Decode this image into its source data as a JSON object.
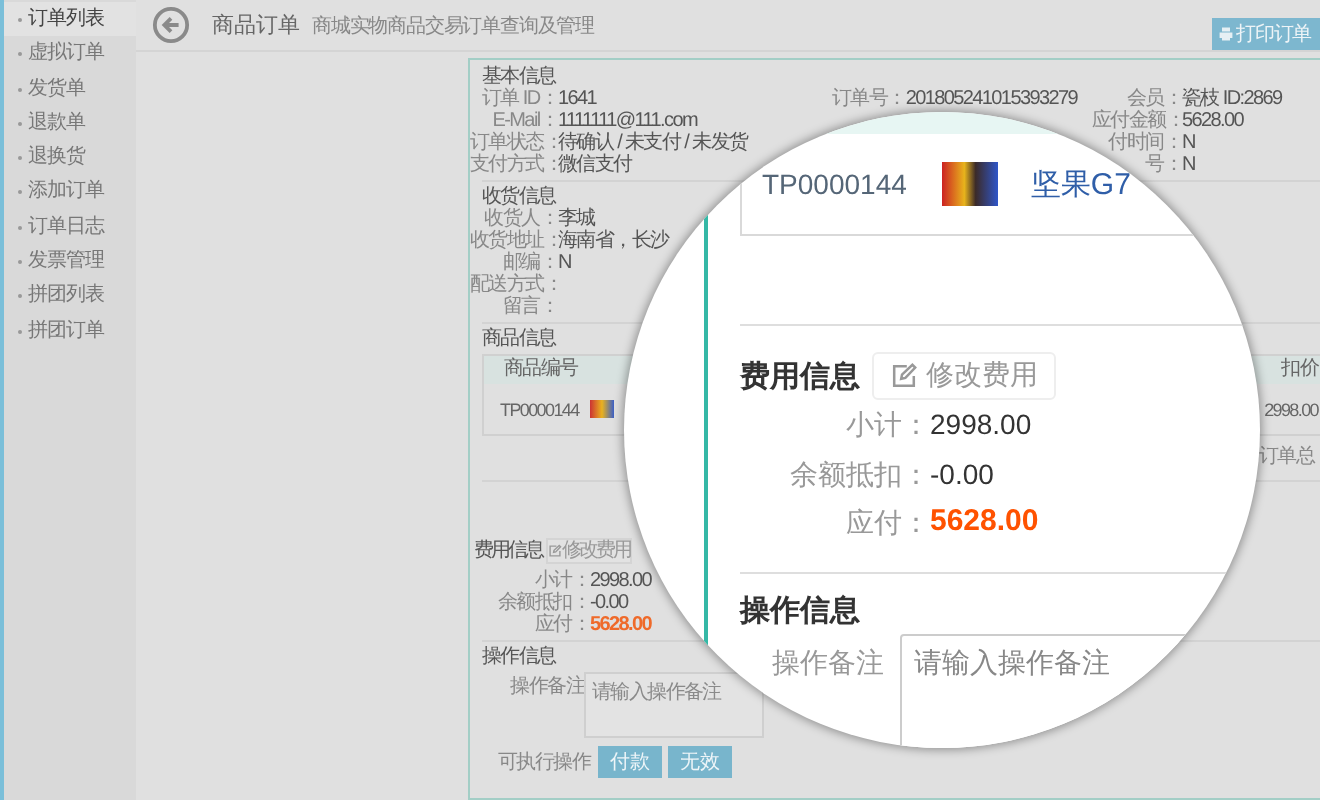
{
  "sidebar": {
    "items": [
      {
        "label": "订单列表",
        "selected": true
      },
      {
        "label": "虚拟订单",
        "selected": false
      },
      {
        "label": "发货单",
        "selected": false
      },
      {
        "label": "退款单",
        "selected": false
      },
      {
        "label": "退换货",
        "selected": false
      },
      {
        "label": "添加订单",
        "selected": false
      },
      {
        "label": "订单日志",
        "selected": false
      },
      {
        "label": "发票管理",
        "selected": false
      },
      {
        "label": "拼团列表",
        "selected": false
      },
      {
        "label": "拼团订单",
        "selected": false
      }
    ]
  },
  "header": {
    "title": "商品订单",
    "subtitle": "商城实物商品交易订单查询及管理",
    "print_button": "打印订单"
  },
  "basic_info": {
    "heading": "基本信息",
    "column_1": [
      {
        "label": "订单 ID：",
        "value": "1641"
      },
      {
        "label": "E-Mail：",
        "value": "1111111@111.com"
      },
      {
        "label": "订单状态：",
        "value": "待确认 / 未支付 / 未发货"
      },
      {
        "label": "支付方式：",
        "value": "微信支付"
      }
    ],
    "column_2": [
      {
        "label": "订单号：",
        "value": "201805241015393279"
      }
    ],
    "column_3": [
      {
        "label": "会员：",
        "value": "瓷枝 ID:2869"
      },
      {
        "label": "应付金额：",
        "value": "5628.00"
      },
      {
        "label": "付时间：",
        "value": "N"
      },
      {
        "label": "号：",
        "value": "N"
      }
    ]
  },
  "receiver_info": {
    "heading": "收货信息",
    "rows": [
      {
        "label": "收货人：",
        "value": "李城"
      },
      {
        "label": "收货地址：",
        "value": "海南省，长沙"
      },
      {
        "label": "邮编：",
        "value": "N"
      },
      {
        "label": "配送方式："
      },
      {
        "label": "留言："
      }
    ]
  },
  "goods_info": {
    "heading": "商品信息",
    "columns": [
      "商品编号",
      "扣价"
    ],
    "rows": [
      {
        "code": "TP0000144",
        "price": "2998.00"
      }
    ],
    "total_label": "订单总"
  },
  "fee_info": {
    "heading": "费用信息",
    "edit_button": "修改费用",
    "rows": [
      {
        "label": "小计：",
        "value": "2998.00",
        "kind": "plain"
      },
      {
        "label": "余额抵扣：",
        "value": "-0.00",
        "kind": "plain"
      },
      {
        "label": "应付：",
        "value": "5628.00",
        "kind": "due"
      }
    ]
  },
  "operation_info": {
    "heading": "操作信息",
    "remark": {
      "label": "操作备注",
      "placeholder": "请输入操作备注"
    },
    "actions_label": "可执行操作",
    "actions": [
      "付款",
      "无效"
    ]
  },
  "magnifier": {
    "product": {
      "code": "TP0000144",
      "name": "坚果G7"
    },
    "fee_info": {
      "heading": "费用信息",
      "edit_button": "修改费用",
      "rows": [
        {
          "label": "小计：",
          "value": "2998.00",
          "kind": "plain"
        },
        {
          "label": "余额抵扣：",
          "value": "-0.00",
          "kind": "plain"
        },
        {
          "label": "应付：",
          "value": "5628.00",
          "kind": "due"
        }
      ]
    },
    "operation_info": {
      "heading": "操作信息",
      "remark": {
        "label": "操作备注",
        "placeholder": "请输入操作备注"
      }
    }
  }
}
